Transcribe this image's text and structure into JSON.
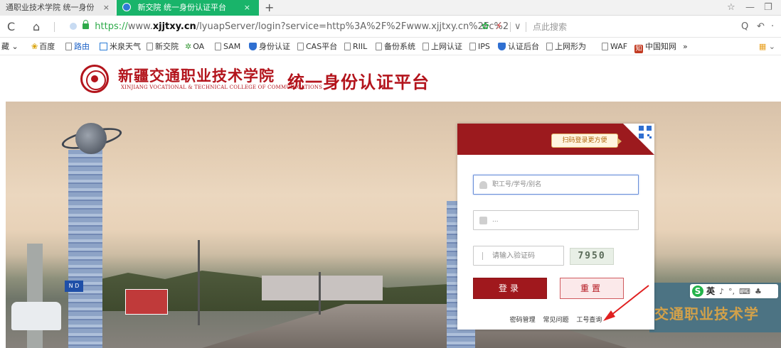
{
  "browser": {
    "tabs": [
      {
        "label": "通职业技术学院 统一身份",
        "close": "×"
      },
      {
        "label": "新交院 统一身份认证平台",
        "close": "×"
      }
    ],
    "new_tab": "+",
    "win_controls": [
      "☆",
      "—",
      "❐"
    ],
    "nav": {
      "back": "C",
      "home": "⌂"
    },
    "url": {
      "proto": "https://",
      "pre_host": "www.",
      "host": "xjjtxy.cn",
      "path": "/lyuapServer/login?service=http%3A%2F%2Fwww.xjjtxy.cn%2Fc%2"
    },
    "search_placeholder": "点此搜索",
    "right_icons": [
      "Q",
      "↶",
      "·"
    ]
  },
  "bookmarks": [
    {
      "label": "藏 ⌄",
      "kind": "text"
    },
    {
      "label": "百度",
      "kind": "paw"
    },
    {
      "label": "路由",
      "kind": "page-blue"
    },
    {
      "label": "米泉天气",
      "kind": "cube"
    },
    {
      "label": "新交院",
      "kind": "page"
    },
    {
      "label": "OA",
      "kind": "gear"
    },
    {
      "label": "SAM",
      "kind": "page"
    },
    {
      "label": "身份认证",
      "kind": "shield"
    },
    {
      "label": "CAS平台",
      "kind": "page"
    },
    {
      "label": "RIIL",
      "kind": "page"
    },
    {
      "label": "备份系统",
      "kind": "page"
    },
    {
      "label": "上网认证",
      "kind": "page"
    },
    {
      "label": "IPS",
      "kind": "page"
    },
    {
      "label": "认证后台",
      "kind": "shield"
    },
    {
      "label": "上网形为",
      "kind": "page"
    },
    {
      "label": "WAF",
      "kind": "page"
    },
    {
      "label": "中国知网",
      "kind": "zhi"
    },
    {
      "label": "»",
      "kind": "text"
    }
  ],
  "bookmarks_right": "⌄",
  "header": {
    "college_cn": "新疆交通职业技术学院",
    "college_en": "XINJIANG VOCATIONAL & TECHNICAL COLLEGE OF COMMUNICATIONS",
    "platform_title": "统一身份认证平台"
  },
  "hero": {
    "wall_text": "交通职业技术学",
    "sign": "N D"
  },
  "ime": {
    "logo": "S",
    "mode": "英",
    "icons": [
      "♪",
      "°,",
      "⌨",
      "♣"
    ]
  },
  "login": {
    "qr_tip": "扫码登录更方便",
    "username_placeholder": "职工号/学号/别名",
    "password_placeholder": "...",
    "captcha_placeholder": "请输入验证码",
    "captcha_code": "7950",
    "login_button": "登录",
    "reset_button": "重置",
    "links": [
      "密码管理",
      "常见问题",
      "工号查询"
    ]
  },
  "colors": {
    "brand": "#b3141c",
    "panel_head": "#9c1a1e",
    "tab_active": "#19b46a",
    "arrow": "#e02020"
  }
}
